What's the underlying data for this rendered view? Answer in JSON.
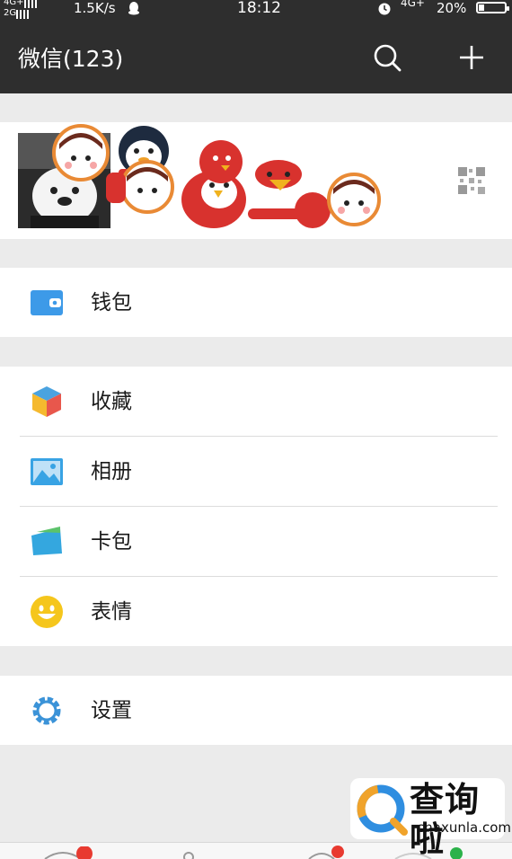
{
  "status_bar": {
    "signal_top": "4G+",
    "signal_bottom": "2G",
    "speed": "1.5K/s",
    "time": "18:12",
    "network": "4G+",
    "battery": "20%"
  },
  "header": {
    "title": "微信(123)",
    "search_icon": "search-icon",
    "add_icon": "plus-icon"
  },
  "profile": {
    "avatar_icon": "avatar",
    "qr_icon": "qr-code-icon"
  },
  "menu": {
    "wallet": {
      "label": "钱包",
      "icon": "wallet-icon",
      "color": "#3d9ae8"
    },
    "favorites": {
      "label": "收藏",
      "icon": "cube-icon",
      "color": "#f5b92e"
    },
    "album": {
      "label": "相册",
      "icon": "photo-icon",
      "color": "#38a3e4"
    },
    "cards": {
      "label": "卡包",
      "icon": "card-icon",
      "color": "#34a7df"
    },
    "stickers": {
      "label": "表情",
      "icon": "smiley-icon",
      "color": "#f5c61c"
    },
    "settings": {
      "label": "设置",
      "icon": "gear-icon",
      "color": "#3b93d8"
    }
  },
  "watermark": {
    "name": "查询啦",
    "domain": "chaxunla.com"
  },
  "colors": {
    "header_bg": "#2e2e2e",
    "page_bg": "#ebebeb"
  }
}
